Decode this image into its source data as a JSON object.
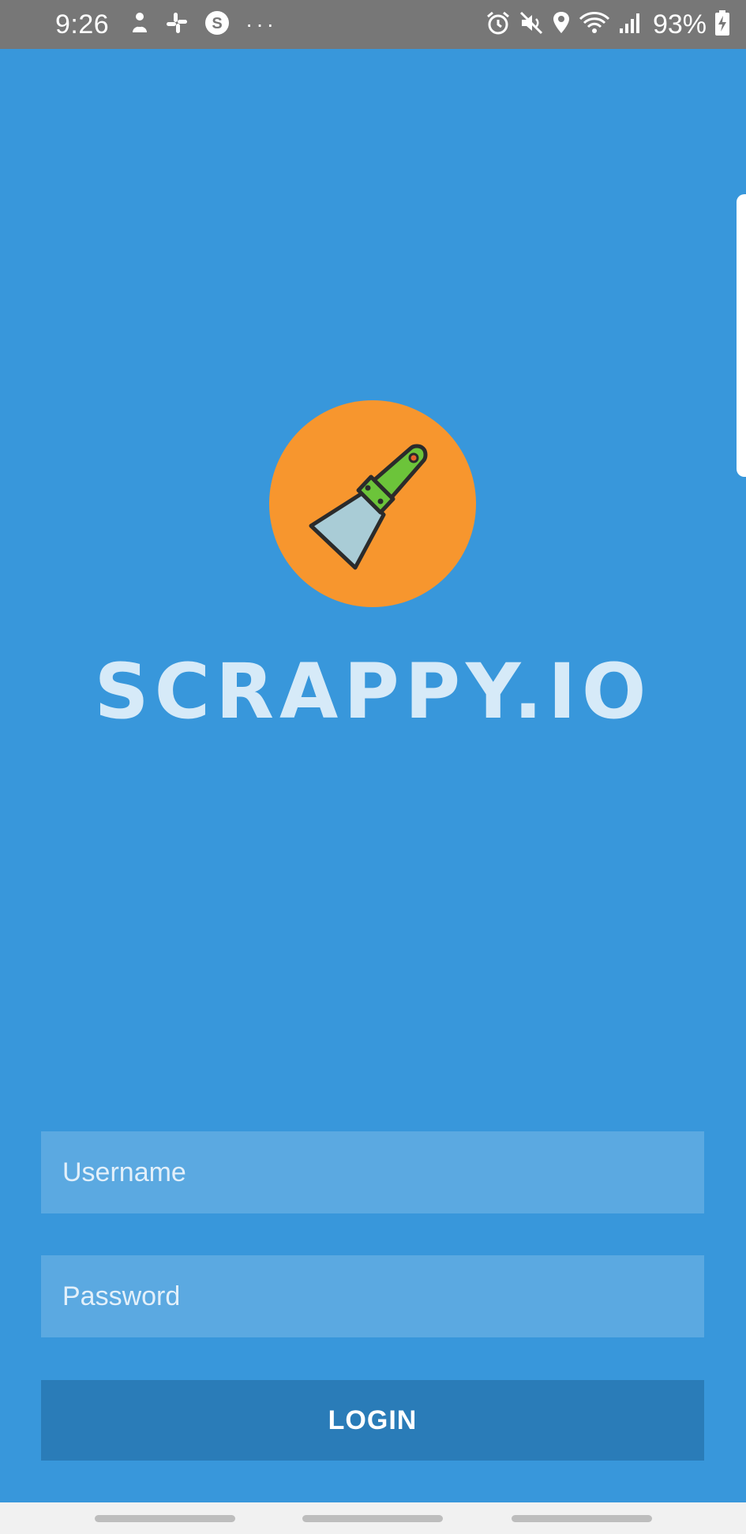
{
  "status_bar": {
    "time": "9:26",
    "battery_percent": "93%",
    "overflow_dots": "···",
    "left_icons": [
      "notification-icon",
      "slack-icon",
      "app-s-icon"
    ],
    "right_icons": [
      "alarm-icon",
      "mute-icon",
      "location-icon",
      "wifi-icon",
      "signal-icon",
      "battery-charging-icon"
    ]
  },
  "app": {
    "logo_icon": "putty-knife-icon",
    "title": "SCRAPPY.IO"
  },
  "login_form": {
    "username_placeholder": "Username",
    "username_value": "",
    "password_placeholder": "Password",
    "password_value": "",
    "login_label": "LOGIN"
  },
  "colors": {
    "background": "#3897DB",
    "field_background": "#5BA9E1",
    "button_background": "#2A7CB8",
    "logo_circle": "#F7962E",
    "logo_handle": "#6CC43A",
    "logo_blade": "#A9CCD6",
    "status_bar": "#777777"
  }
}
